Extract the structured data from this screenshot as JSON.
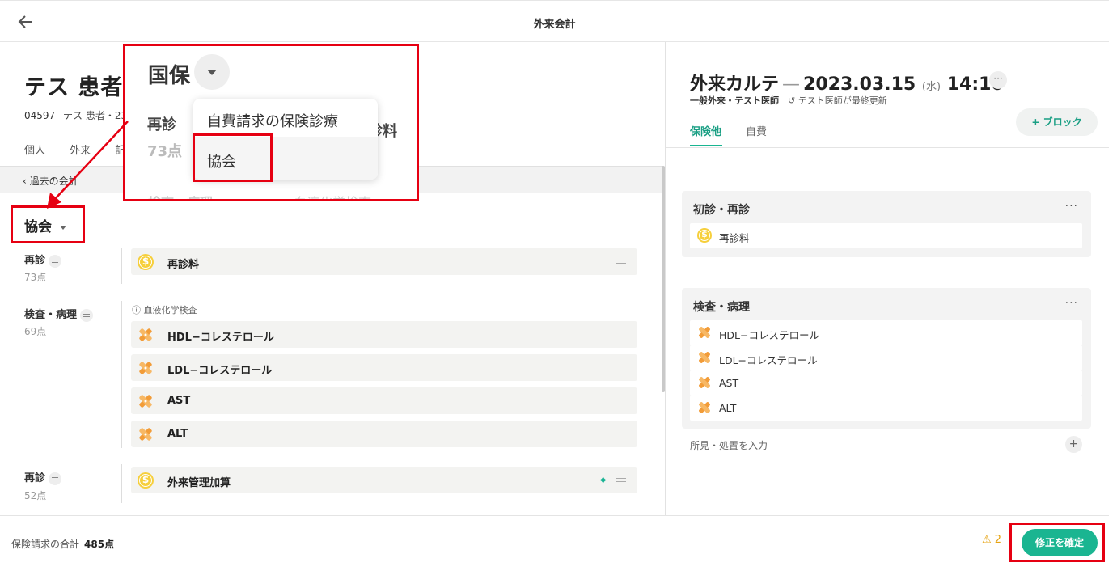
{
  "topbar": {
    "title": "外来会計",
    "back_icon": "arrow-left-icon"
  },
  "patient": {
    "name": "テス 患者",
    "id": "04597",
    "meta": "テス 患者・23歳"
  },
  "left_tabs": [
    "個人",
    "外来",
    "記"
  ],
  "past_link": "過去の会計",
  "payer": "協会",
  "groups": [
    {
      "label": "再診",
      "points": "73点",
      "items": [
        {
          "name": "再診料",
          "icon": "coin-icon"
        }
      ]
    },
    {
      "label": "検査・病理",
      "points": "69点",
      "sublabel": "血液化学検査",
      "items": [
        {
          "name": "HDL−コレステロール",
          "icon": "bandage-icon"
        },
        {
          "name": "LDL−コレステロール",
          "icon": "bandage-icon"
        },
        {
          "name": "AST",
          "icon": "bandage-icon"
        },
        {
          "name": "ALT",
          "icon": "bandage-icon"
        }
      ]
    },
    {
      "label": "再診",
      "points": "52点",
      "items": [
        {
          "name": "外来管理加算",
          "icon": "coin-icon"
        }
      ]
    }
  ],
  "footer": {
    "sum_label": "保険請求の合計",
    "sum_value": "485点",
    "warning_count": "2",
    "confirm_label": "修正を確定"
  },
  "chart": {
    "title_prefix": "外来カルテ",
    "dash": "—",
    "date": "2023.03.15",
    "dow": "(水)",
    "time": "14:10",
    "more": "···",
    "type": "一般外来",
    "doctor": "テスト医師",
    "updated_by": "テスト医師",
    "updated_suffix": "が最終更新",
    "tabs": [
      "保険他",
      "自費"
    ],
    "add_block": "+ ブロック",
    "cards": [
      {
        "title": "初診・再診",
        "rows": [
          {
            "name": "再診料",
            "icon": "coin-icon"
          }
        ]
      },
      {
        "title": "検査・病理",
        "rows": [
          {
            "name": "HDL−コレステロール",
            "icon": "bandage-icon"
          },
          {
            "name": "LDL−コレステロール",
            "icon": "bandage-icon"
          },
          {
            "name": "AST",
            "icon": "bandage-icon"
          },
          {
            "name": "ALT",
            "icon": "bandage-icon"
          }
        ]
      }
    ],
    "findings_placeholder": "所見・処置を入力"
  },
  "overlay": {
    "title": "国保",
    "ghost_left": "再診",
    "ghost_points": "73点",
    "ghost_right": "診料",
    "ghost_bottom_left": "検査・病理",
    "ghost_bottom_right": "血液化学検査",
    "menu": [
      "自費請求の保険診療",
      "協会"
    ]
  },
  "colors": {
    "accent": "#1ab591",
    "highlight": "#e60012",
    "warning": "#e6a312",
    "coin": "#f6cf3c",
    "bandage": "#f29c38"
  }
}
